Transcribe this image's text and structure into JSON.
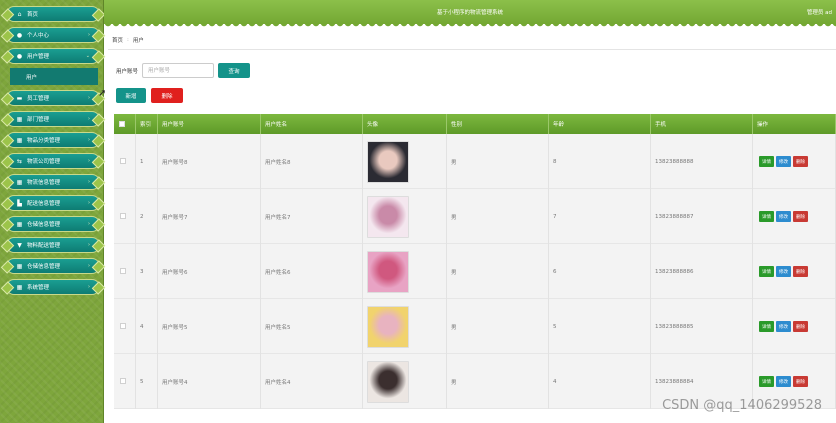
{
  "header": {
    "title": "基于小程序的物流管理系统",
    "user": "管理员 ad"
  },
  "sidebar": {
    "items": [
      {
        "label": "首页",
        "icon": "home-icon",
        "glyph": "⌂"
      },
      {
        "label": "个人中心",
        "icon": "user-icon",
        "glyph": "●"
      },
      {
        "label": "用户管理",
        "icon": "users-icon",
        "glyph": "●"
      },
      {
        "label": "员工管理",
        "icon": "staff-icon",
        "glyph": "▬"
      },
      {
        "label": "部门管理",
        "icon": "grid-icon",
        "glyph": "▦"
      },
      {
        "label": "物品分类管理",
        "icon": "grid-icon",
        "glyph": "▦"
      },
      {
        "label": "物流公司管理",
        "icon": "exchange-icon",
        "glyph": "⇆"
      },
      {
        "label": "物流信息管理",
        "icon": "grid-icon",
        "glyph": "▦"
      },
      {
        "label": "配送信息管理",
        "icon": "chart-icon",
        "glyph": "▙"
      },
      {
        "label": "仓储信息管理",
        "icon": "grid-icon",
        "glyph": "▦"
      },
      {
        "label": "物料配送管理",
        "icon": "filter-icon",
        "glyph": "▼"
      },
      {
        "label": "仓储信息管理",
        "icon": "grid-icon",
        "glyph": "▦"
      },
      {
        "label": "系统管理",
        "icon": "grid-icon",
        "glyph": "▦"
      }
    ],
    "submenu": "用户"
  },
  "breadcrumb": {
    "home": "首页",
    "sep": ":",
    "current": "用户"
  },
  "search": {
    "label": "用户账号",
    "placeholder": "用户账号",
    "button": "查询"
  },
  "actions": {
    "add": "新增",
    "delete": "删除"
  },
  "table": {
    "headers": [
      "索引",
      "用户账号",
      "用户姓名",
      "头像",
      "性别",
      "年龄",
      "手机",
      "操作"
    ],
    "rows": [
      {
        "index": "1",
        "account": "用户账号8",
        "name": "用户姓名8",
        "gender": "男",
        "age": "8",
        "phone": "13823888888"
      },
      {
        "index": "2",
        "account": "用户账号7",
        "name": "用户姓名7",
        "gender": "男",
        "age": "7",
        "phone": "13823888887"
      },
      {
        "index": "3",
        "account": "用户账号6",
        "name": "用户姓名6",
        "gender": "男",
        "age": "6",
        "phone": "13823888886"
      },
      {
        "index": "4",
        "account": "用户账号5",
        "name": "用户姓名5",
        "gender": "男",
        "age": "5",
        "phone": "13823888885"
      },
      {
        "index": "5",
        "account": "用户账号4",
        "name": "用户姓名4",
        "gender": "男",
        "age": "4",
        "phone": "13823888884"
      }
    ],
    "ops": {
      "detail": "详情",
      "edit": "修改",
      "delete": "删除"
    }
  },
  "watermark": "CSDN @qq_1406299528",
  "colors": {
    "accent": "#14938a",
    "header": "#7db83f",
    "danger": "#e0201e"
  }
}
